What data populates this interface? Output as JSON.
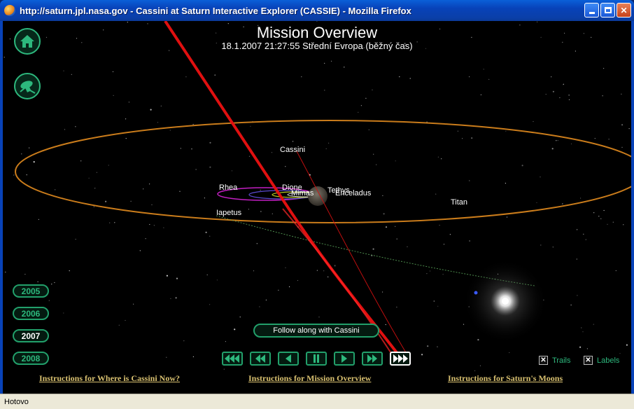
{
  "window": {
    "title": "http://saturn.jpl.nasa.gov - Cassini at Saturn Interactive Explorer (CASSIE) - Mozilla Firefox",
    "status": "Hotovo"
  },
  "header": {
    "title": "Mission Overview",
    "datetime": "18.1.2007 21:27:55 Střední Evropa (běžný čas)"
  },
  "years": [
    "2005",
    "2006",
    "2007",
    "2008"
  ],
  "selected_year": "2007",
  "follow_button": "Follow along with Cassini",
  "playback_controls": [
    "skip-to-start",
    "rewind",
    "step-back",
    "pause",
    "step-forward",
    "fast-forward",
    "skip-to-end"
  ],
  "toggles": {
    "trails_label": "Trails",
    "labels_label": "Labels",
    "trails_checked": "✕",
    "labels_checked": "✕"
  },
  "links": {
    "where_is_cassini": "Instructions for Where is Cassini Now?",
    "mission_overview": "Instructions for Mission Overview",
    "saturns_moons": "Instructions for Saturn's Moons"
  },
  "labels": {
    "cassini": "Cassini",
    "rhea": "Rhea",
    "dione": "Dione",
    "mimas": "Mimas",
    "tethys": "Tethys",
    "enceladus": "Enceladus",
    "titan": "Titan",
    "iapetus": "Iapetus"
  },
  "colors": {
    "accent": "#2db87d",
    "trajectory": "#e01010",
    "titan_orbit": "#e08a1e",
    "link": "#d8c070"
  }
}
